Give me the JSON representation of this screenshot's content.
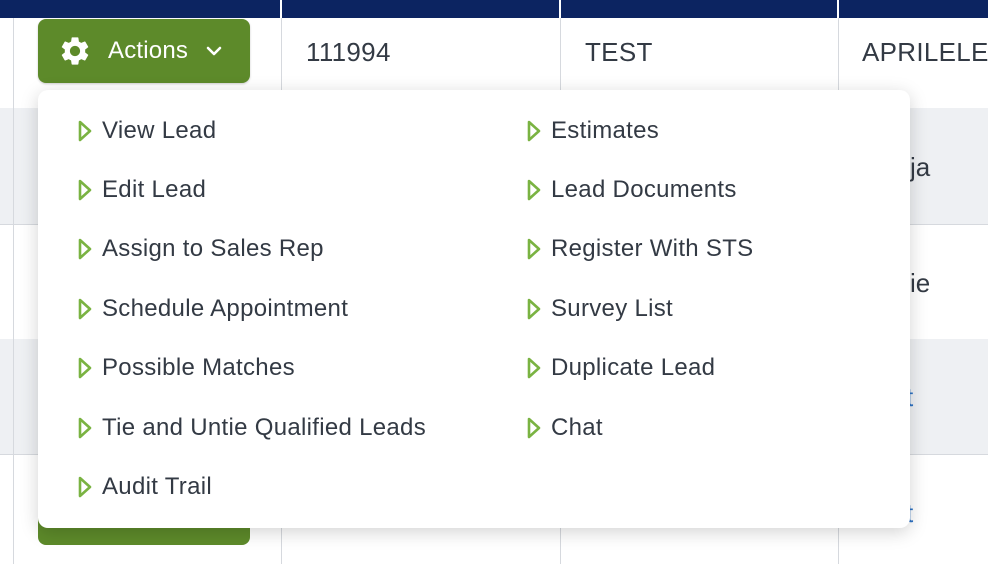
{
  "colors": {
    "header": "#0c2461",
    "accent": "#5d8a2a",
    "menu_arrow": "#7ab342",
    "link": "#2d72c4"
  },
  "actions_button": {
    "label": "Actions",
    "icon": "gear-icon",
    "caret_icon": "chevron-down-icon"
  },
  "table": {
    "first_row": {
      "lead_id": "111994",
      "first_name": "TEST",
      "last_name": "APRILELEV"
    },
    "peek_cells": [
      "ja",
      "ie",
      "t",
      "t"
    ]
  },
  "menu": {
    "item_icon": "triangle-right-icon",
    "left_column": [
      "View Lead",
      "Edit Lead",
      "Assign to Sales Rep",
      "Schedule Appointment",
      "Possible Matches",
      "Tie and Untie Qualified Leads",
      "Audit Trail"
    ],
    "right_column": [
      "Estimates",
      "Lead Documents",
      "Register With STS",
      "Survey List",
      "Duplicate Lead",
      "Chat"
    ]
  }
}
